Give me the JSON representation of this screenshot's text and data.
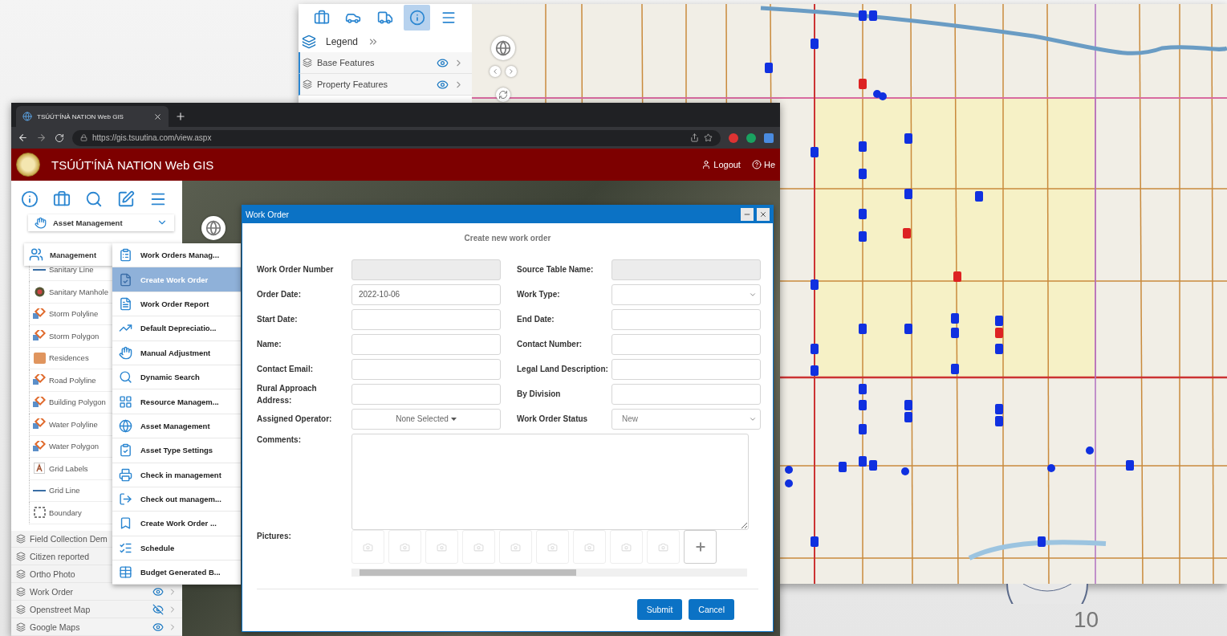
{
  "back_window": {
    "toolbar": [
      {
        "selected": false
      },
      {
        "selected": false
      },
      {
        "selected": false
      },
      {
        "selected": true
      },
      {
        "selected": false
      }
    ],
    "legend": {
      "label": "Legend"
    },
    "layers": [
      {
        "label": "Base Features",
        "visible": true
      },
      {
        "label": "Property Features",
        "visible": true
      }
    ]
  },
  "browser": {
    "tab_title": "TSÚÚT'ÍNÀ NATION Web GIS",
    "url": "https://gis.tsuutina.com/view.aspx"
  },
  "header": {
    "title": "TSÚÚT'ÍNÀ NATION Web GIS",
    "actions": [
      {
        "kind": "logout",
        "label": "Logout"
      },
      {
        "kind": "help",
        "label": "He"
      }
    ]
  },
  "sidebar": {
    "dropdown": {
      "label": "Asset Management"
    },
    "tree": [
      {
        "label": "Sanitary Line",
        "kind": "line"
      },
      {
        "label": "Sanitary Manhole",
        "kind": "point"
      },
      {
        "label": "Storm Polyline",
        "kind": "feature"
      },
      {
        "label": "Storm Polygon",
        "kind": "feature"
      },
      {
        "label": "Residences",
        "kind": "fill"
      },
      {
        "label": "Road Polyline",
        "kind": "feature"
      },
      {
        "label": "Building Polygon",
        "kind": "feature"
      },
      {
        "label": "Water Polyline",
        "kind": "feature"
      },
      {
        "label": "Water Polygon",
        "kind": "feature"
      },
      {
        "label": "Grid Labels",
        "kind": "text"
      },
      {
        "label": "Grid Line",
        "kind": "line"
      },
      {
        "label": "Boundary",
        "kind": "boundary"
      }
    ],
    "layers": [
      {
        "label": "Field Collection Dem"
      },
      {
        "label": "Citizen reported"
      },
      {
        "label": "Ortho Photo"
      },
      {
        "label": "Work Order",
        "visible": true
      },
      {
        "label": "Openstreet Map",
        "visible": false
      },
      {
        "label": "Google Maps",
        "visible": true
      }
    ]
  },
  "menu": {
    "header": "Management",
    "items": [
      {
        "label": "Work Orders Manag...",
        "selected": false
      },
      {
        "label": "Create Work Order",
        "selected": true
      },
      {
        "label": "Work Order Report",
        "selected": false
      },
      {
        "label": "Default Depreciatio...",
        "selected": false
      },
      {
        "label": "Manual Adjustment",
        "selected": false
      },
      {
        "label": "Dynamic Search",
        "selected": false
      },
      {
        "label": "Resource Managem...",
        "selected": false
      },
      {
        "label": "Asset Management",
        "selected": false
      },
      {
        "label": "Asset Type Settings",
        "selected": false
      },
      {
        "label": "Check in management",
        "selected": false
      },
      {
        "label": "Check out managem...",
        "selected": false
      },
      {
        "label": "Create Work Order ...",
        "selected": false
      },
      {
        "label": "Schedule",
        "selected": false
      },
      {
        "label": "Budget Generated B...",
        "selected": false
      }
    ]
  },
  "dialog": {
    "title": "Work Order",
    "heading": "Create new work order",
    "rows": [
      [
        {
          "label": "Work Order Number",
          "kind": "disabled"
        },
        {
          "label": "Source Table Name:",
          "kind": "disabled"
        }
      ],
      [
        {
          "label": "Order Date:",
          "kind": "text",
          "value": "2022-10-06"
        },
        {
          "label": "Work Type:",
          "kind": "select"
        }
      ],
      [
        {
          "label": "Start Date:",
          "kind": "text"
        },
        {
          "label": "End Date:",
          "kind": "text"
        }
      ],
      [
        {
          "label": "Name:",
          "kind": "text"
        },
        {
          "label": "Contact Number:",
          "kind": "text"
        }
      ],
      [
        {
          "label": "Contact Email:",
          "kind": "text"
        },
        {
          "label": "Legal Land Description:",
          "kind": "text"
        }
      ],
      [
        {
          "label": "Rural Approach Address:",
          "kind": "text"
        },
        {
          "label": "By Division",
          "kind": "text"
        }
      ],
      [
        {
          "label": "Assigned Operator:",
          "kind": "multiselect",
          "value": "None Selected"
        },
        {
          "label": "Work Order Status",
          "kind": "select",
          "value": "New"
        }
      ]
    ],
    "comments": {
      "label": "Comments:"
    },
    "pictures": {
      "label": "Pictures:",
      "slots": [
        {
          "kind": "photo"
        },
        {
          "kind": "photo"
        },
        {
          "kind": "photo"
        },
        {
          "kind": "photo"
        },
        {
          "kind": "photo"
        },
        {
          "kind": "photo"
        },
        {
          "kind": "photo"
        },
        {
          "kind": "photo"
        },
        {
          "kind": "photo"
        },
        {
          "kind": "add"
        }
      ]
    },
    "buttons": [
      {
        "label": "Submit"
      },
      {
        "label": "Cancel"
      }
    ]
  },
  "slide_number": "10"
}
